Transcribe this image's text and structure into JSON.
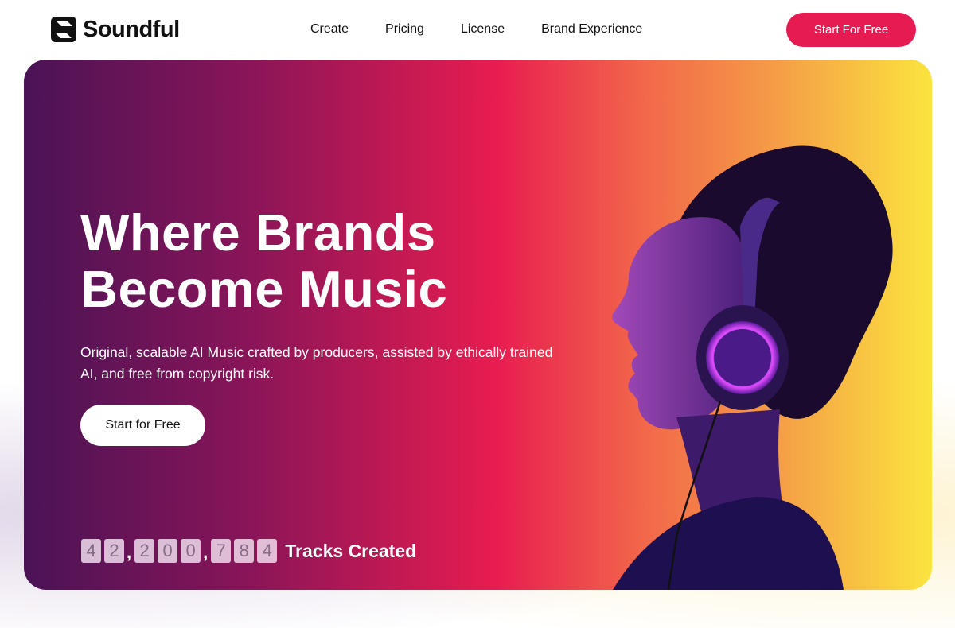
{
  "brand": {
    "name": "Soundful",
    "logo_icon": "soundful-s-logo"
  },
  "nav": {
    "links": [
      "Create",
      "Pricing",
      "License",
      "Brand Experience"
    ],
    "cta": "Start For Free"
  },
  "hero": {
    "title_line1": "Where Brands",
    "title_line2": "Become Music",
    "subtitle": "Original, scalable AI Music crafted by producers, assisted by ethically trained AI, and free from copyright risk.",
    "cta": "Start for Free",
    "counter": {
      "digits": [
        "4",
        "2",
        "2",
        "0",
        "0",
        "7",
        "8",
        "4"
      ],
      "label": "Tracks Created"
    },
    "image": "woman-with-headphones-profile"
  },
  "colors": {
    "accent": "#e51b52",
    "gradient": [
      "#4a1356",
      "#e81c50",
      "#fbe43e"
    ],
    "headphone_glow": "#e04cff"
  }
}
